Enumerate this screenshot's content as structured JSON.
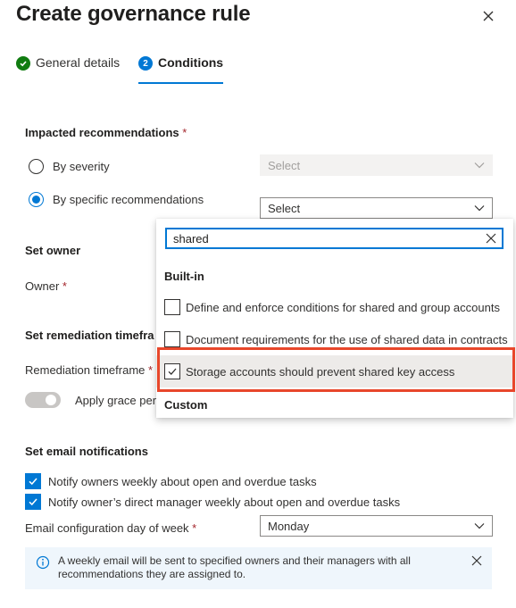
{
  "title": "Create governance rule",
  "tabs": {
    "general": "General details",
    "conditions": "Conditions",
    "conditions_step": "2"
  },
  "impacted": {
    "title": "Impacted recommendations",
    "required": "*",
    "by_severity": "By severity",
    "by_specific": "By specific recommendations",
    "severity_select": "Select",
    "specific_select": "Select"
  },
  "owner": {
    "title": "Set owner",
    "label": "Owner",
    "required": "*"
  },
  "remediation": {
    "title": "Set remediation timefra",
    "label": "Remediation timeframe",
    "required": "*",
    "grace_label": "Apply grace per"
  },
  "email": {
    "title": "Set email notifications",
    "notify_owners": "Notify owners weekly about open and overdue tasks",
    "notify_manager": "Notify owner’s direct manager weekly about open and overdue tasks",
    "config_label": "Email configuration day of week",
    "required": "*",
    "day_value": "Monday",
    "info_text": "A weekly email will be sent to specified owners and their managers with all recommendations they are assigned to."
  },
  "dropdown": {
    "search_value": "shared",
    "group_builtin": "Built-in",
    "options": [
      {
        "label": "Define and enforce conditions for shared and group accounts",
        "checked": false
      },
      {
        "label": "Document requirements for the use of shared data in contracts",
        "checked": false
      },
      {
        "label": "Storage accounts should prevent shared key access",
        "checked": true
      }
    ],
    "group_custom": "Custom"
  },
  "colors": {
    "accent": "#0078d4",
    "success": "#107c10",
    "highlight": "#e8472b"
  },
  "icons": [
    "close-icon",
    "checkmark-circle-icon",
    "chevron-down-icon",
    "info-icon",
    "checkmark-icon"
  ]
}
